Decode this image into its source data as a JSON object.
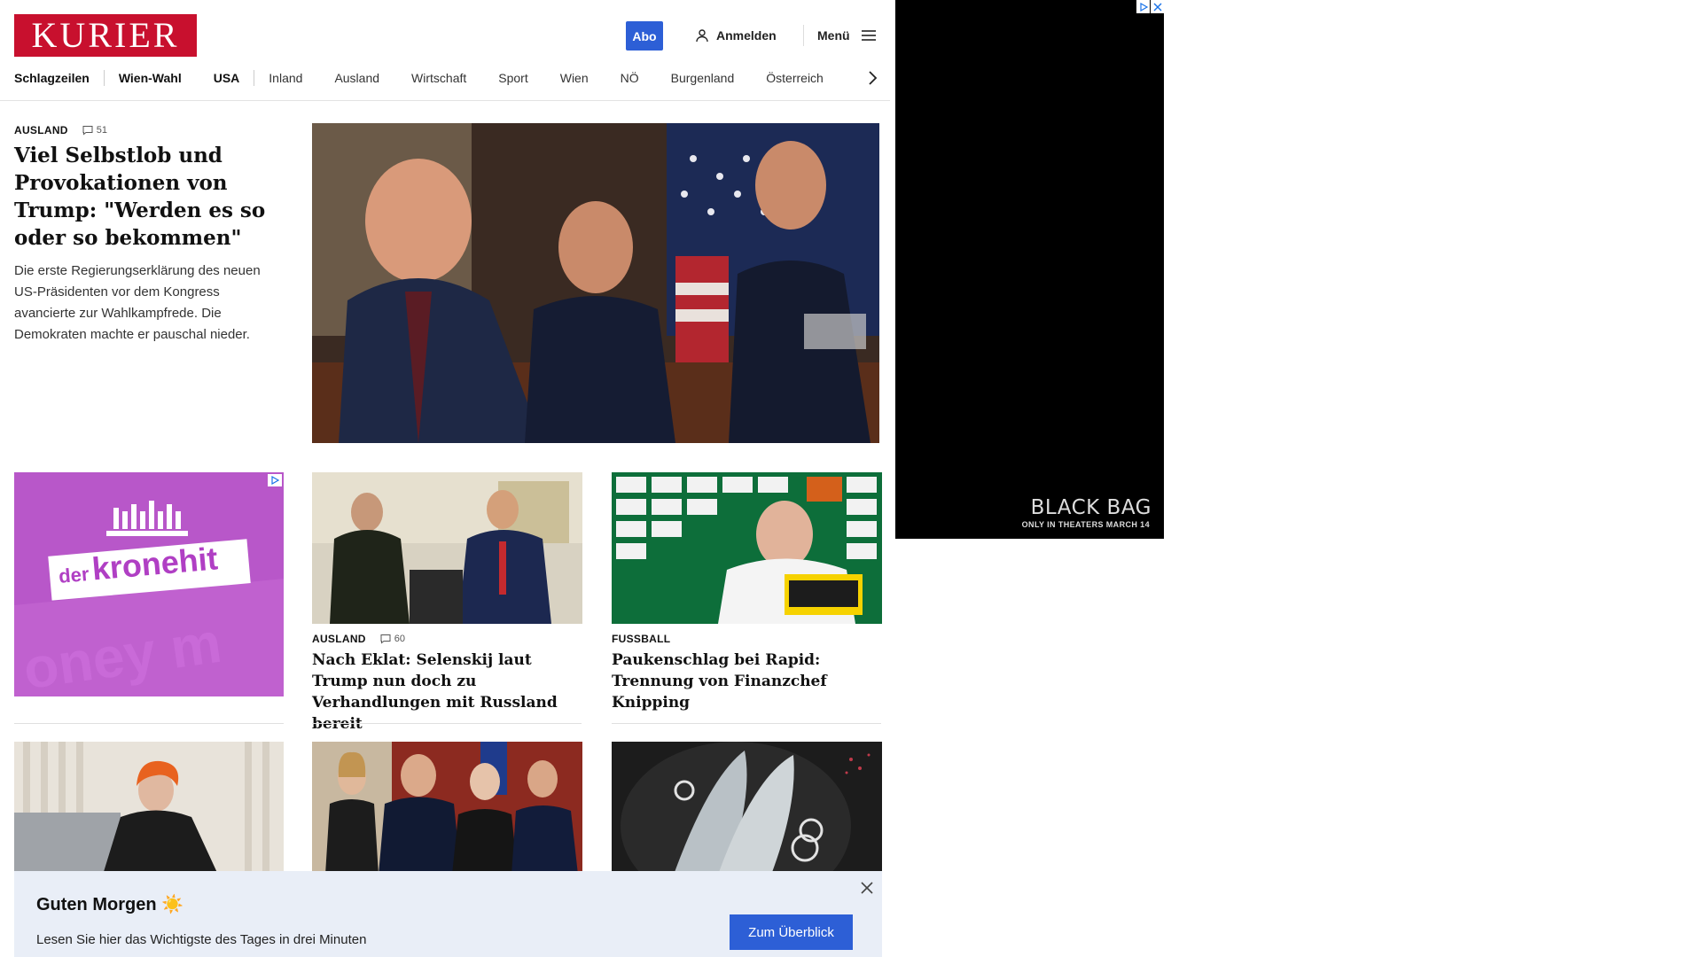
{
  "header": {
    "logo_text": "KURIER",
    "abo_label": "Abo",
    "login_label": "Anmelden",
    "menu_label": "Menü"
  },
  "nav": {
    "items": [
      "Schlagzeilen",
      "Wien-Wahl",
      "USA",
      "Inland",
      "Ausland",
      "Wirtschaft",
      "Sport",
      "Wien",
      "NÖ",
      "Burgenland",
      "Österreich"
    ],
    "more_icon": "chevron-right-icon"
  },
  "lead": {
    "section": "AUSLAND",
    "comments": "51",
    "title": "Viel Selbstlob und Provokationen von Trump: \"Werden es so oder so bekommen\"",
    "teaser": "Die erste Regierungserklärung des neuen US-Präsidenten vor dem Kongress avancierte zur Wahlkampfrede. Die Demokraten machte er pauschal nieder."
  },
  "ad_kronehit": {
    "brand_prefix": "der",
    "brand_name": "kronehit",
    "bg_text": "oney m"
  },
  "cards": [
    {
      "section": "AUSLAND",
      "comments": "60",
      "title": "Nach Eklat: Selenskij laut Trump nun doch zu Verhandlungen mit Russland bereit"
    },
    {
      "section": "FUSSBALL",
      "title": "Paukenschlag bei Rapid: Trennung von Finanzchef Knipping"
    }
  ],
  "side_ad": {
    "brand": "BLACK BAG",
    "tagline": "ONLY IN THEATERS MARCH 14"
  },
  "banner": {
    "title": "Guten Morgen ☀️",
    "text": "Lesen Sie hier das Wichtigste des Tages in drei Minuten",
    "button": "Zum Überblick"
  },
  "colors": {
    "brand_red": "#c8102e",
    "accent_blue": "#2d5fd6",
    "banner_bg": "#e9eef7",
    "ad_purple": "#b857c9"
  }
}
